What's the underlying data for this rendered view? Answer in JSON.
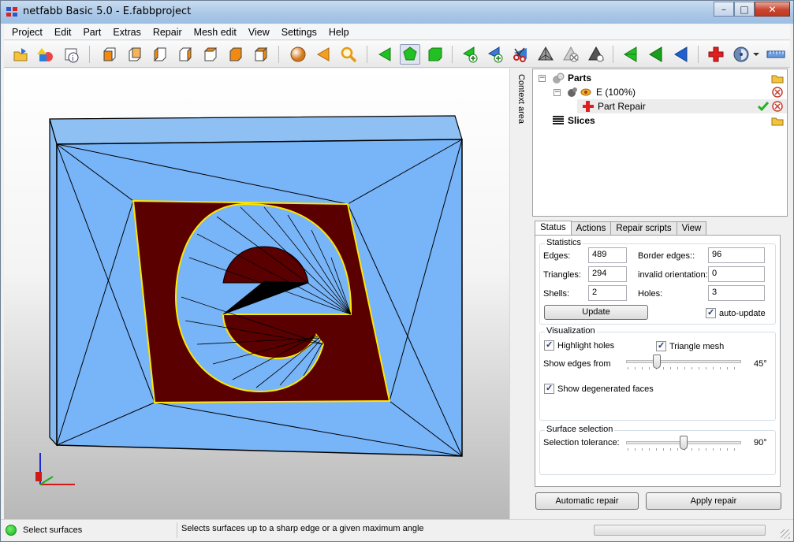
{
  "window": {
    "title": "netfabb Basic 5.0 - E.fabbproject",
    "controls": {
      "minimize": "–",
      "maximize": "□",
      "close": "✕"
    }
  },
  "menu": [
    "Project",
    "Edit",
    "Part",
    "Extras",
    "Repair",
    "Mesh edit",
    "View",
    "Settings",
    "Help"
  ],
  "toolbar": {
    "icons": [
      "open-project-icon",
      "add-part-icon",
      "part-info-icon",
      "view-front-icon",
      "view-back-icon",
      "view-left-icon",
      "view-right-icon",
      "view-top-icon",
      "view-bottom-icon",
      "view-iso-icon",
      "shaded-sphere-icon",
      "back-arrow-icon",
      "zoom-icon",
      "select-triangles-icon",
      "select-surfaces-icon",
      "select-shells-icon",
      "add-triangle-icon",
      "add-point-icon",
      "cut-icon",
      "tetra-icon",
      "remove-tetra-icon",
      "tetra-dark-icon",
      "select-green-icon",
      "select-green2-icon",
      "select-blue-icon",
      "repair-cross-icon",
      "settings-disc-icon",
      "measure-ruler-icon"
    ],
    "active": "select-surfaces-icon"
  },
  "context_area_label": "Context area",
  "tree": {
    "parts": "Parts",
    "part_name": "E (100%)",
    "repair_item": "Part Repair",
    "slices": "Slices"
  },
  "tabs": [
    "Status",
    "Actions",
    "Repair scripts",
    "View"
  ],
  "active_tab": "Status",
  "statistics": {
    "title": "Statistics",
    "edges_label": "Edges:",
    "edges": "489",
    "triangles_label": "Triangles:",
    "triangles": "294",
    "shells_label": "Shells:",
    "shells": "2",
    "border_edges_label": "Border edges::",
    "border_edges": "96",
    "invalid_orientation_label": "invalid orientation:",
    "invalid_orientation": "0",
    "holes_label": "Holes:",
    "holes": "3",
    "update_button": "Update",
    "auto_update": "auto-update",
    "auto_update_checked": true
  },
  "visualization": {
    "title": "Visualization",
    "highlight_holes": "Highlight holes",
    "triangle_mesh": "Triangle mesh",
    "show_edges_label": "Show edges from",
    "show_edges_value": "45°",
    "show_edges_level": 0.25,
    "show_degenerated": "Show degenerated faces"
  },
  "surface_selection": {
    "title": "Surface selection",
    "tolerance_label": "Selection tolerance:",
    "tolerance_value": "90°",
    "tolerance_level": 0.5
  },
  "buttons": {
    "automatic_repair": "Automatic repair",
    "apply_repair": "Apply repair"
  },
  "status": {
    "mode": "Select surfaces",
    "message": "Selects surfaces up to a sharp edge or a given maximum angle"
  },
  "colors": {
    "mesh_face": "#78b4f8",
    "selected_surface": "#5a0000",
    "border_highlight": "#ffff00",
    "ok_green": "#22b322"
  }
}
